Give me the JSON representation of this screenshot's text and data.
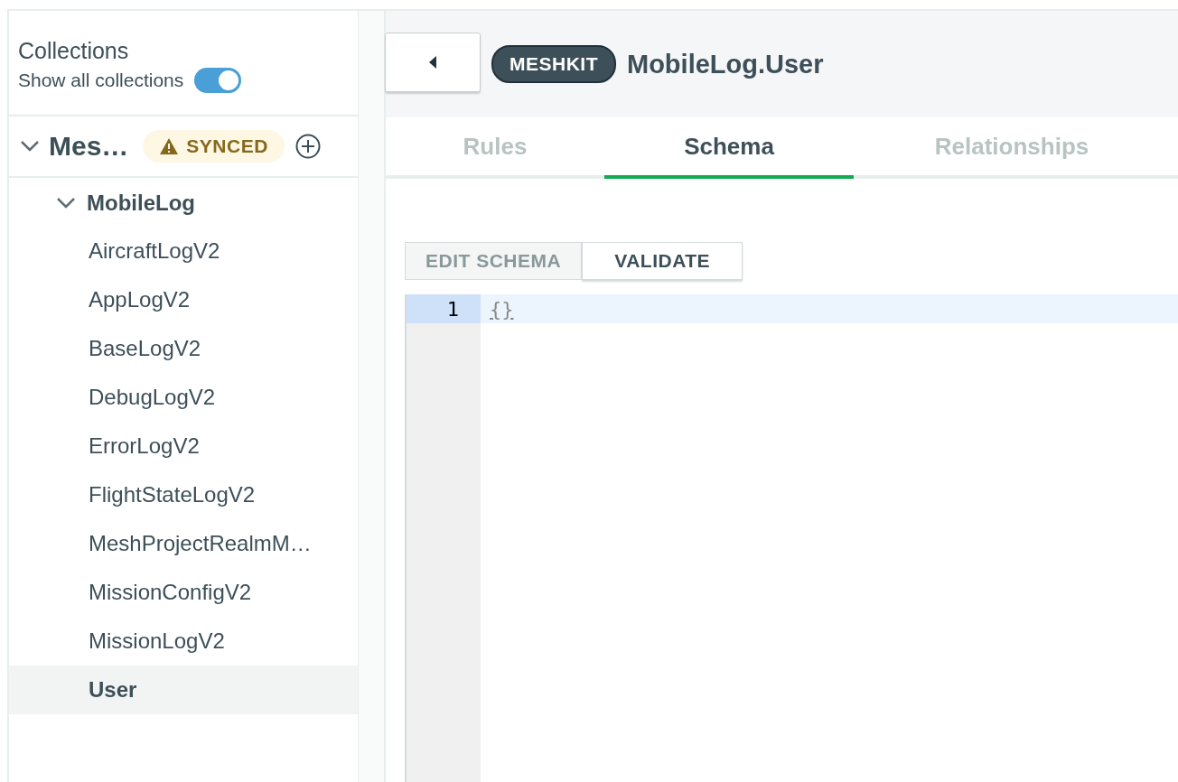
{
  "sidebar": {
    "title": "Collections",
    "show_all": {
      "label": "Show all collections",
      "on": true
    },
    "cluster": {
      "name": "Mes…",
      "expanded": true,
      "status": "SYNCED",
      "databases": [
        {
          "name": "MobileLog",
          "expanded": true,
          "children": [
            {
              "name": "AircraftLogV2",
              "selected": false
            },
            {
              "name": "AppLogV2",
              "selected": false
            },
            {
              "name": "BaseLogV2",
              "selected": false
            },
            {
              "name": "DebugLogV2",
              "selected": false
            },
            {
              "name": "ErrorLogV2",
              "selected": false
            },
            {
              "name": "FlightStateLogV2",
              "selected": false
            },
            {
              "name": "MeshProjectRealmM…",
              "selected": false
            },
            {
              "name": "MissionConfigV2",
              "selected": false
            },
            {
              "name": "MissionLogV2",
              "selected": false
            },
            {
              "name": "User",
              "selected": true
            }
          ]
        }
      ]
    }
  },
  "header": {
    "badge": "MESHKIT",
    "title": "MobileLog.User"
  },
  "tabs": [
    {
      "label": "Rules",
      "selected": false
    },
    {
      "label": "Schema",
      "selected": true
    },
    {
      "label": "Relationships",
      "selected": false
    }
  ],
  "schema_modes": [
    {
      "label": "EDIT SCHEMA",
      "selected": false
    },
    {
      "label": "VALIDATE",
      "selected": true
    }
  ],
  "editor": {
    "lines": [
      {
        "number": "1",
        "text": "{}",
        "active": true
      }
    ]
  }
}
